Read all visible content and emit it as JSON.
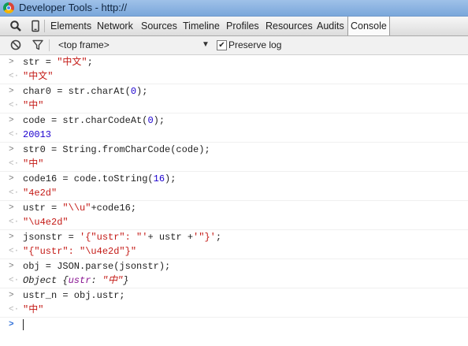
{
  "window": {
    "title": "Developer Tools - http://"
  },
  "tabs": [
    {
      "label": "Elements"
    },
    {
      "label": "Network"
    },
    {
      "label": "Sources"
    },
    {
      "label": "Timeline"
    },
    {
      "label": "Profiles"
    },
    {
      "label": "Resources"
    },
    {
      "label": "Audits"
    },
    {
      "label": "Console"
    }
  ],
  "console_toolbar": {
    "frame_select": "<top frame>",
    "preserve_log_label": "Preserve log",
    "preserve_log_checked": true
  },
  "console": {
    "entries": [
      {
        "input": [
          "str = ",
          "\"中文\"",
          ";"
        ],
        "output": "\"中文\""
      },
      {
        "input": [
          "char0 = str.charAt(",
          "0",
          ");"
        ],
        "output": "\"中\""
      },
      {
        "input": [
          "code = str.charCodeAt(",
          "0",
          ");"
        ],
        "output": "20013"
      },
      {
        "input": [
          "str0 = String.fromCharCode(code);"
        ],
        "output": "\"中\""
      },
      {
        "input": [
          "code16 = code.toString(",
          "16",
          ");"
        ],
        "output": "\"4e2d\""
      },
      {
        "input": [
          "ustr = ",
          "\"\\\\u\"",
          "+code16;"
        ],
        "output": "\"\\u4e2d\""
      },
      {
        "input": [
          "jsonstr = ",
          "'{\"ustr\": \"'",
          "+ ustr +",
          "'\"}'",
          ";"
        ],
        "output": "\"{\"ustr\": \"\\u4e2d\"}\""
      },
      {
        "input": [
          "obj = JSON.parse(jsonstr);"
        ],
        "output": [
          "Object {",
          "ustr",
          ": ",
          "\"中\"",
          "}"
        ]
      },
      {
        "input": [
          "ustr_n = obj.ustr;"
        ],
        "output": "\"中\""
      }
    ],
    "input_glyph": ">",
    "output_glyph": "<·"
  },
  "icons": {
    "search": "search-icon",
    "device": "device-mode-icon",
    "clear": "clear-console-icon",
    "filter": "filter-icon",
    "prompt": "prompt-chevron-icon",
    "favicon": "chrome-logo-icon"
  },
  "colors": {
    "string": "#c41a16",
    "number": "#1c00cf",
    "prompt": "#2f6fd8",
    "titlebar": "#7aa7db"
  }
}
